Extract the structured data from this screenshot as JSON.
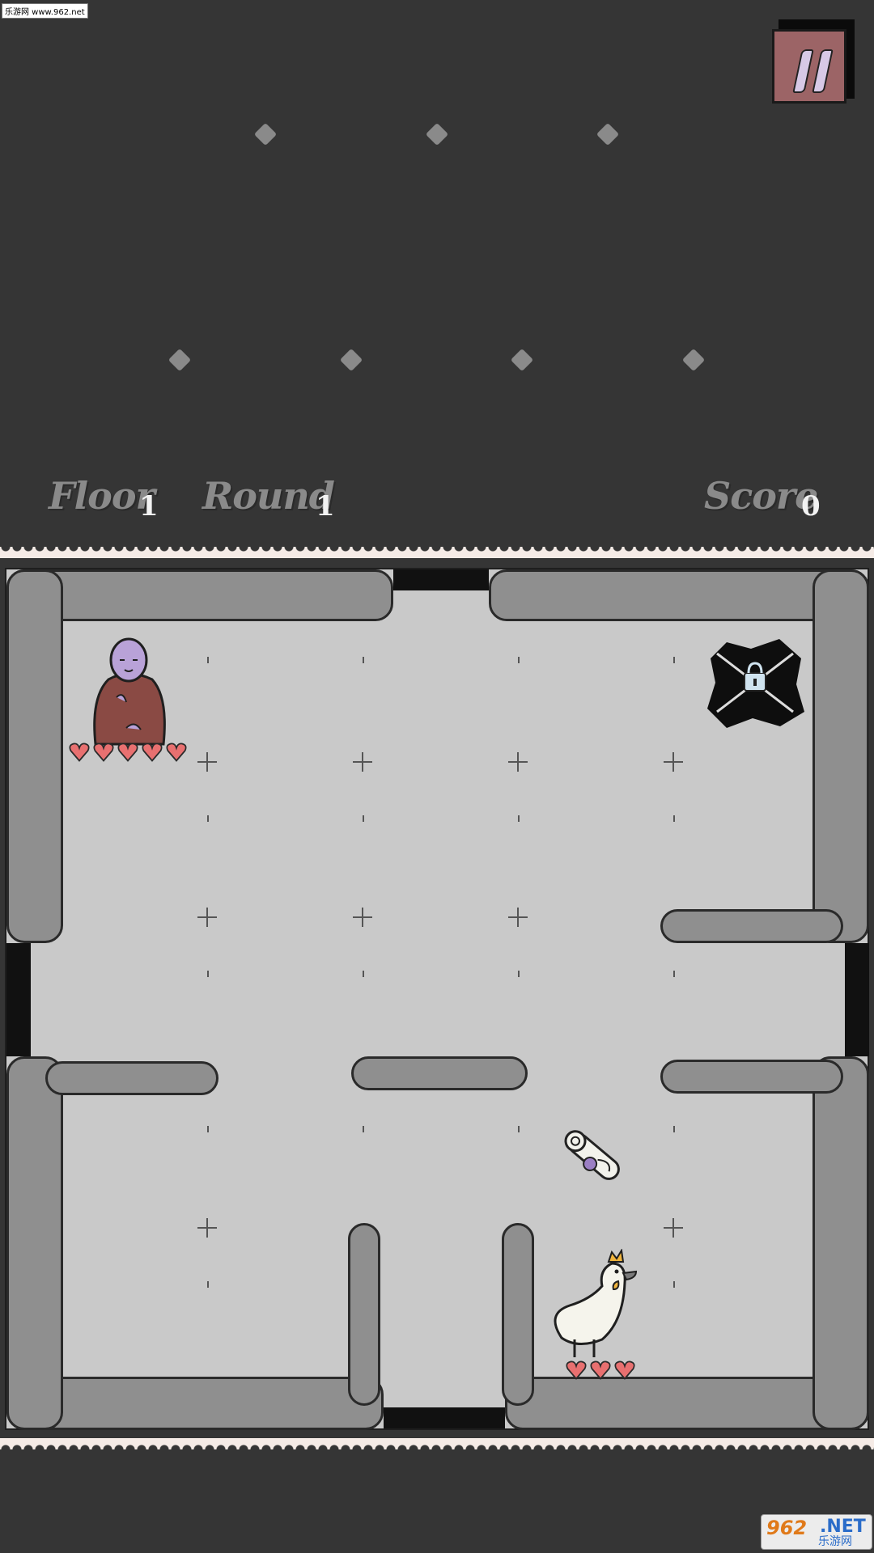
{
  "watermark": {
    "top_left": "乐游网 www.962.net",
    "bottom_right_brand": "962",
    "bottom_right_net": ".NET",
    "bottom_right_cn": "乐游网"
  },
  "hud": {
    "floor_label": "Floor",
    "floor_value": "1",
    "round_label": "Round",
    "round_value": "1",
    "score_label": "Score",
    "score_value": "0"
  },
  "pause_button": {
    "icon": "pause-icon",
    "color": "#9c6466"
  },
  "player": {
    "name_icon": "monk-icon",
    "hearts": 5
  },
  "enemy": {
    "name_icon": "chicken-icon",
    "hearts": 3
  },
  "items": {
    "scroll_icon": "scroll-icon",
    "locked_exit_icon": "chained-lock-icon"
  },
  "colors": {
    "background": "#353535",
    "board": "#c9c9c9",
    "wall": "#8f8f8f",
    "heart": "#e87070",
    "robe": "#8a4a44",
    "skin": "#b9a2d8"
  }
}
